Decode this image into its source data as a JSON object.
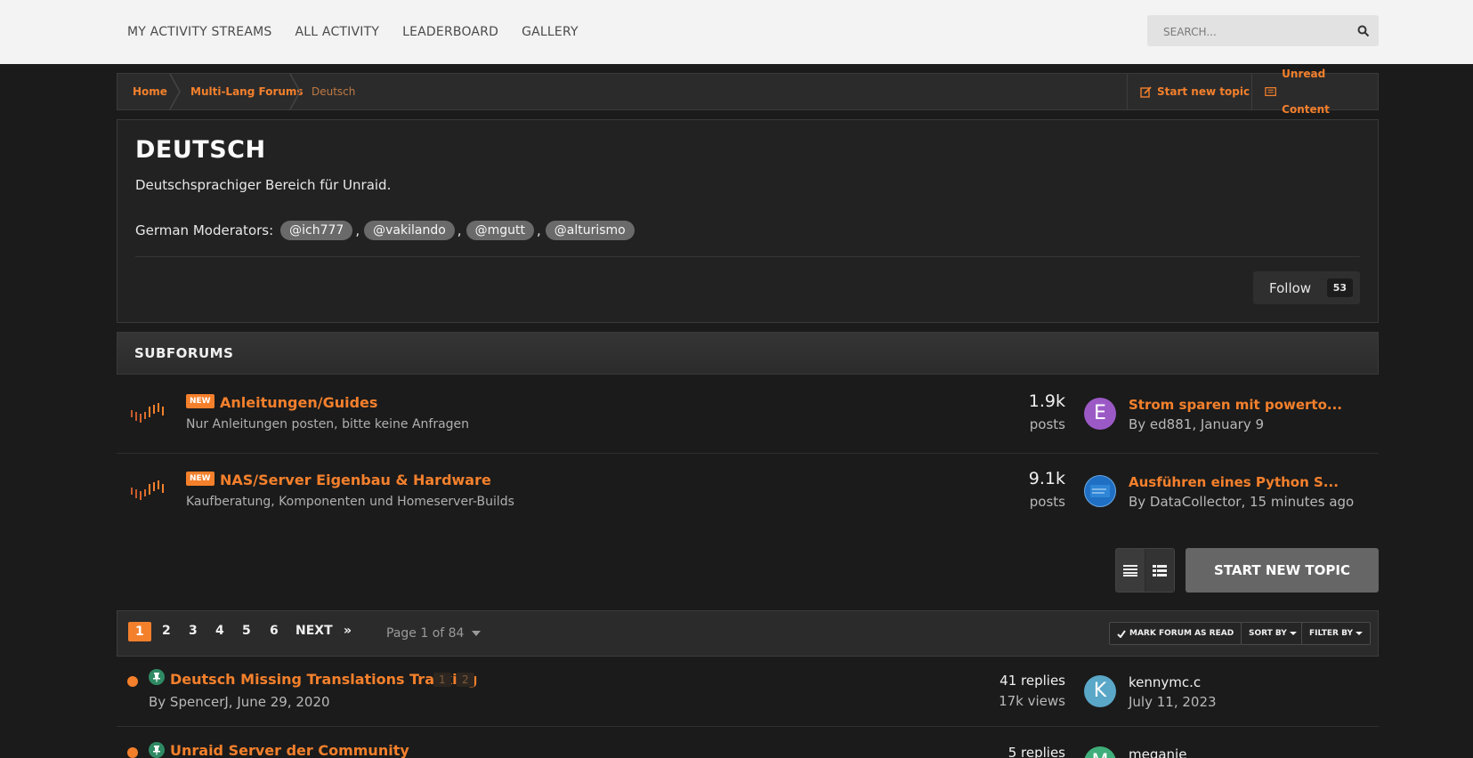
{
  "topnav": {
    "items": [
      "MY ACTIVITY STREAMS",
      "ALL ACTIVITY",
      "LEADERBOARD",
      "GALLERY"
    ]
  },
  "search": {
    "placeholder": "SEARCH..."
  },
  "breadcrumb": {
    "items": [
      "Home",
      "Multi-Lang Forums",
      "Deutsch"
    ],
    "start_new_topic": "Start new topic",
    "unread_content": "Unread Content"
  },
  "forum": {
    "title": "DEUTSCH",
    "description": "Deutschsprachiger Bereich für Unraid.",
    "moderators_label": "German Moderators:",
    "moderators": [
      "@ich777",
      "@vakilando",
      "@mgutt",
      "@alturismo"
    ],
    "follow_label": "Follow",
    "follow_count": "53"
  },
  "subforums": {
    "heading": "SUBFORUMS",
    "items": [
      {
        "badge": "NEW",
        "title": "Anleitungen/Guides",
        "description": "Nur Anleitungen posten, bitte keine Anfragen",
        "count": "1.9k",
        "count_label": "posts",
        "avatar_letter": "E",
        "avatar_color": "#9b59c6",
        "last_title": "Strom sparen mit powerto...",
        "last_by": "By ed881, January 9"
      },
      {
        "badge": "NEW",
        "title": "NAS/Server Eigenbau & Hardware",
        "description": "Kaufberatung, Komponenten und Homeserver-Builds",
        "count": "9.1k",
        "count_label": "posts",
        "avatar_letter": "",
        "avatar_color": "#1f6fc4",
        "last_title": "Ausführen eines Python S...",
        "last_by": "By DataCollector, 15 minutes ago"
      }
    ]
  },
  "actions": {
    "start_new_topic": "START NEW TOPIC"
  },
  "pagination": {
    "pages": [
      "1",
      "2",
      "3",
      "4",
      "5",
      "6"
    ],
    "next": "NEXT",
    "last": "»",
    "page_of": "Page 1 of 84",
    "mark_read": "MARK FORUM AS READ",
    "sort_by": "SORT BY",
    "filter_by": "FILTER BY"
  },
  "topics": [
    {
      "title": "Deutsch Missing Translations Tracking",
      "pages": [
        "1",
        "2"
      ],
      "by": "By SpencerJ, June 29, 2020",
      "replies": "41 replies",
      "views": "17k views",
      "avatar_letter": "K",
      "avatar_color": "#5aa7c8",
      "last_name": "kennymc.c",
      "last_date": "July 11, 2023"
    },
    {
      "title": "Unraid Server der Community",
      "pages": [],
      "by": "",
      "replies": "5 replies",
      "views": "",
      "avatar_letter": "M",
      "avatar_color": "#3fae7a",
      "last_name": "meganie",
      "last_date": ""
    }
  ],
  "colors": {
    "accent": "#f4802c",
    "pinned": "#2f8a63"
  }
}
